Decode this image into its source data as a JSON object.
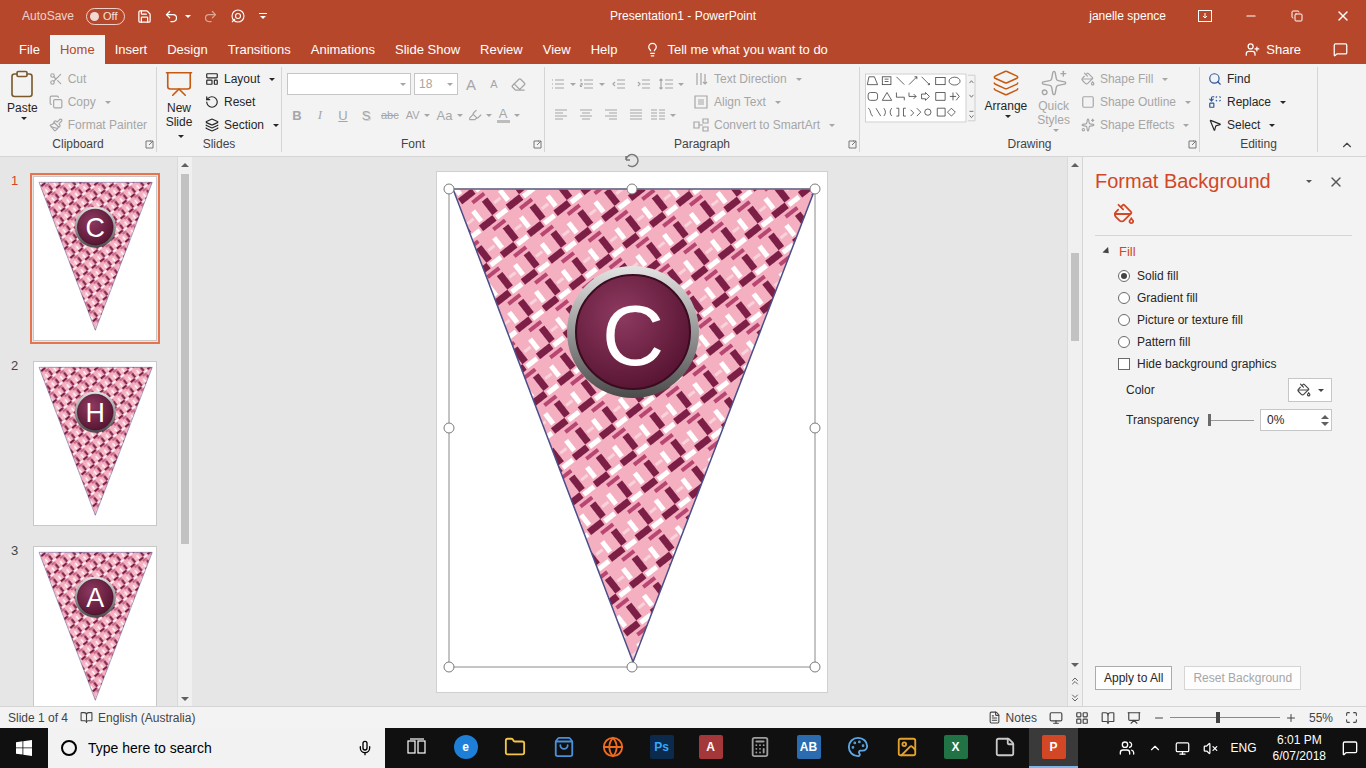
{
  "titlebar": {
    "autosave": "AutoSave",
    "autosave_on": false,
    "autosave_state": "Off",
    "title": "Presentation1 - PowerPoint",
    "user": "janelle spence"
  },
  "tabs": [
    {
      "label": "File",
      "selected": false
    },
    {
      "label": "Home",
      "selected": true
    },
    {
      "label": "Insert",
      "selected": false
    },
    {
      "label": "Design",
      "selected": false
    },
    {
      "label": "Transitions",
      "selected": false
    },
    {
      "label": "Animations",
      "selected": false
    },
    {
      "label": "Slide Show",
      "selected": false
    },
    {
      "label": "Review",
      "selected": false
    },
    {
      "label": "View",
      "selected": false
    },
    {
      "label": "Help",
      "selected": false
    }
  ],
  "tell_me": "Tell me what you want to do",
  "share": "Share",
  "ribbon": {
    "clipboard": {
      "label": "Clipboard",
      "paste": {
        "label": "Paste",
        "disabled": false,
        "menu": true
      },
      "items": [
        {
          "label": "Cut",
          "disabled": true,
          "menu": false
        },
        {
          "label": "Copy",
          "disabled": true,
          "menu": true
        },
        {
          "label": "Format Painter",
          "disabled": true,
          "menu": false
        }
      ]
    },
    "slides": {
      "label": "Slides",
      "new_slide": {
        "label": "New Slide",
        "disabled": false,
        "menu": true
      },
      "items": [
        {
          "label": "Layout",
          "disabled": false,
          "menu": true
        },
        {
          "label": "Reset",
          "disabled": false,
          "menu": false
        },
        {
          "label": "Section",
          "disabled": false,
          "menu": true
        }
      ]
    },
    "font": {
      "label": "Font",
      "disabled": true,
      "size": "18",
      "row1": [
        {
          "label": "A",
          "kind": "grow"
        },
        {
          "label": "A",
          "kind": "shrink"
        },
        {
          "kind": "clear"
        }
      ],
      "row2": [
        {
          "label": "B",
          "kind": "bold",
          "menu": false
        },
        {
          "label": "I",
          "kind": "italic",
          "menu": false
        },
        {
          "label": "U",
          "kind": "underline",
          "menu": false
        },
        {
          "label": "S",
          "kind": "shadow",
          "menu": false
        },
        {
          "label": "abc",
          "kind": "strike",
          "menu": false
        },
        {
          "label": "AV",
          "kind": "spacing",
          "menu": true
        },
        {
          "label": "Aa",
          "kind": "case",
          "menu": true
        },
        {
          "kind": "highlight",
          "menu": true
        },
        {
          "label": "A",
          "kind": "color",
          "menu": true
        }
      ]
    },
    "paragraph": {
      "label": "Paragraph",
      "disabled": true,
      "items": [
        {
          "label": "Text Direction",
          "menu": true
        },
        {
          "label": "Align Text",
          "menu": true
        },
        {
          "label": "Convert to SmartArt",
          "menu": true
        }
      ]
    },
    "drawing": {
      "label": "Drawing",
      "arrange": {
        "label": "Arrange",
        "disabled": false,
        "menu": true
      },
      "quick_styles": {
        "label": "Quick Styles",
        "disabled": true,
        "menu": true
      },
      "items": [
        {
          "label": "Shape Fill",
          "disabled": true,
          "menu": true
        },
        {
          "label": "Shape Outline",
          "disabled": true,
          "menu": true
        },
        {
          "label": "Shape Effects",
          "disabled": true,
          "menu": true
        }
      ]
    },
    "editing": {
      "label": "Editing",
      "items": [
        {
          "label": "Find",
          "disabled": false,
          "menu": false
        },
        {
          "label": "Replace",
          "disabled": false,
          "menu": true
        },
        {
          "label": "Select",
          "disabled": false,
          "menu": true
        }
      ]
    }
  },
  "slides": [
    {
      "number": "1",
      "letter": "C",
      "selected": true
    },
    {
      "number": "2",
      "letter": "H",
      "selected": false
    },
    {
      "number": "3",
      "letter": "A",
      "selected": false
    }
  ],
  "thumb_scroll": {
    "level": 0
  },
  "canvas": {
    "shape_selected": true,
    "scroll_level": 0.2
  },
  "pane": {
    "title": "Format Background",
    "section": "Fill",
    "expanded": true,
    "fills": [
      {
        "label": "Solid fill",
        "selected": true
      },
      {
        "label": "Gradient fill",
        "selected": false
      },
      {
        "label": "Picture or texture fill",
        "selected": false
      },
      {
        "label": "Pattern fill",
        "selected": false
      }
    ],
    "hide_graphics": {
      "label": "Hide background graphics",
      "checked": false
    },
    "color": {
      "label": "Color"
    },
    "transparency": {
      "label": "Transparency",
      "value": "0%",
      "level": 0
    },
    "buttons": [
      {
        "label": "Apply to All",
        "disabled": false
      },
      {
        "label": "Reset Background",
        "disabled": true
      }
    ]
  },
  "status": {
    "slide": "Slide 1 of 4",
    "language": "English (Australia)",
    "notes": "Notes",
    "zoom": "55%",
    "zoom_level": 0.43
  },
  "taskbar": {
    "search": "Type here to search",
    "apps": [
      {
        "kind": "taskview",
        "active": false
      },
      {
        "kind": "edge",
        "label": "e",
        "color": "#1E7FD8",
        "active": false
      },
      {
        "kind": "explorer",
        "color": "#F3C54A",
        "active": false
      },
      {
        "kind": "store",
        "color": "#4A90D9",
        "active": false
      },
      {
        "kind": "firefox",
        "color": "#F06B1D",
        "active": false
      },
      {
        "kind": "photoshop",
        "label": "Ps",
        "color": "#0C2A4B",
        "active": false
      },
      {
        "kind": "access",
        "label": "A",
        "color": "#A4373A",
        "active": false
      },
      {
        "kind": "calculator",
        "color": "#9E9E9E",
        "active": false
      },
      {
        "kind": "letters",
        "label": "AB",
        "color": "#2B6CB0",
        "active": false
      },
      {
        "kind": "paint",
        "color": "#5CA8E6",
        "active": false
      },
      {
        "kind": "photos",
        "color": "#E5A22B",
        "active": false
      },
      {
        "kind": "excel",
        "label": "X",
        "color": "#217346",
        "active": false
      },
      {
        "kind": "notes",
        "color": "#C9C9C9",
        "active": false
      },
      {
        "kind": "powerpoint",
        "label": "P",
        "color": "#D24726",
        "active": true
      }
    ],
    "language": "ENG",
    "time": "6:01 PM",
    "date": "6/07/2018"
  }
}
